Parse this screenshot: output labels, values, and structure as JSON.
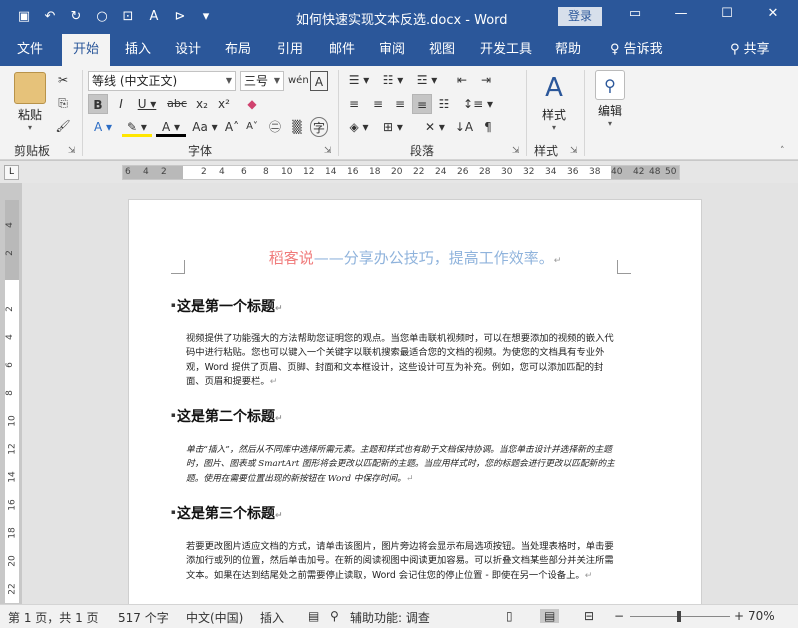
{
  "titlebar": {
    "title": "如何快速实现文本反选.docx  -  Word",
    "login": "登录",
    "bg": "#2b579a"
  },
  "tabs": [
    "文件",
    "开始",
    "插入",
    "设计",
    "布局",
    "引用",
    "邮件",
    "审阅",
    "视图",
    "开发工具",
    "帮助"
  ],
  "tellme": "告诉我",
  "share": "共享",
  "ribbon": {
    "clipboard": {
      "paste": "粘贴",
      "label": "剪贴板"
    },
    "font": {
      "name": "等线 (中文正文)",
      "size": "三号",
      "label": "字体"
    },
    "paragraph": {
      "label": "段落"
    },
    "styles": {
      "button": "样式",
      "label": "样式"
    },
    "editing": {
      "button": "编辑"
    }
  },
  "ruler": {
    "h_ticks": [
      "6",
      "4",
      "2",
      "2",
      "4",
      "6",
      "8",
      "10",
      "12",
      "14",
      "16",
      "18",
      "20",
      "22",
      "24",
      "26",
      "28",
      "30",
      "32",
      "34",
      "36",
      "38",
      "40",
      "42",
      "46",
      "48",
      "50"
    ],
    "v_ticks": [
      "4",
      "2",
      "2",
      "4",
      "6",
      "8",
      "10",
      "12",
      "14",
      "16",
      "18",
      "20",
      "22"
    ]
  },
  "document": {
    "header_red": "稻客说",
    "header_blue": "——分享办公技巧，提高工作效率。",
    "headings": [
      "这是第一个标题",
      "这是第二个标题",
      "这是第三个标题"
    ],
    "paras": [
      "视频提供了功能强大的方法帮助您证明您的观点。当您单击联机视频时，可以在想要添加的视频的嵌入代码中进行粘贴。您也可以键入一个关键字以联机搜索最适合您的文档的视频。为使您的文档具有专业外观，Word 提供了页眉、页脚、封面和文本框设计，这些设计可互为补充。例如，您可以添加匹配的封面、页眉和提要栏。",
      "单击“插入”，然后从不同库中选择所需元素。主题和样式也有助于文档保持协调。当您单击设计并选择新的主题时，图片、图表或 SmartArt 图形将会更改以匹配新的主题。当应用样式时，您的标题会进行更改以匹配新的主题。使用在需要位置出现的新按钮在 Word 中保存时间。",
      "若要更改图片适应文档的方式，请单击该图片，图片旁边将会显示布局选项按钮。当处理表格时，单击要添加行或列的位置，然后单击加号。在新的阅读视图中阅读更加容易。可以折叠文档某些部分并关注所需文本。如果在达到结尾处之前需要停止读取，Word 会记住您的停止位置 - 即使在另一个设备上。"
    ]
  },
  "status": {
    "page": "第 1 页，共 1 页",
    "words": "517 个字",
    "lang": "中文(中国)",
    "mode": "插入",
    "accessibility": "辅助功能: 调查",
    "zoom": "70%"
  }
}
